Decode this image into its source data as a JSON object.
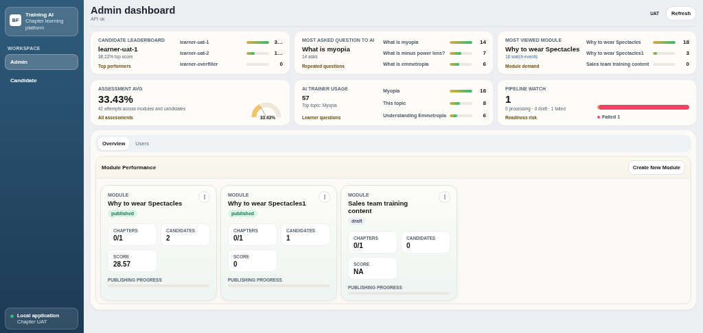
{
  "sidebar": {
    "brand": {
      "initials": "BF",
      "title": "Training AI",
      "subtitle": "Chapter learning platform"
    },
    "section": "WORKSPACE",
    "items": [
      {
        "label": "Admin",
        "selected": true
      },
      {
        "label": "Candidate",
        "selected": false
      }
    ],
    "footer": {
      "title": "Local application",
      "subtitle": "Chapter UAT",
      "connected": true
    }
  },
  "header": {
    "title": "Admin dashboard",
    "subtitle": "API ok",
    "environment": "UAT",
    "button": "Refresh"
  },
  "cards": [
    {
      "kind": "bars",
      "label": "CANDIDATE LEADERBOARD",
      "title": "learner-uat-1",
      "subtitle": "38.22% top score",
      "footer": "Top performers",
      "rows": [
        {
          "label": "learner-uat-1",
          "value": "3…",
          "level": 1
        },
        {
          "label": "learner-uat-2",
          "value": "1…",
          "level": 0.35
        },
        {
          "label": "learner-overfiller",
          "value": "0",
          "level": 0
        }
      ]
    },
    {
      "kind": "bars",
      "label": "MOST ASKED QUESTION TO AI",
      "title": "What is myopia",
      "subtitle": "14 asks",
      "footer": "Repeated questions",
      "rows": [
        {
          "label": "What is myopia",
          "value": "14",
          "level": 1
        },
        {
          "label": "What is minus power lens?",
          "value": "7",
          "level": 0.5
        },
        {
          "label": "What is emmetropia",
          "value": "6",
          "level": 0.43
        }
      ]
    },
    {
      "kind": "bars",
      "label": "MOST VIEWED MODULE",
      "title": "Why to wear Spectacles",
      "subtitle": "18 watch events",
      "footer": "Module demand",
      "rows": [
        {
          "label": "Why to wear Spectacles",
          "value": "18",
          "level": 1
        },
        {
          "label": "Why to wear Spectacles1",
          "value": "3",
          "level": 0.17
        },
        {
          "label": "Sales team training content",
          "value": "0",
          "level": 0
        }
      ]
    },
    {
      "kind": "gauge",
      "label": "ASSESSMENT AVG",
      "title": "33.43%",
      "subtitle": "42 attempts across modules and candidates",
      "footer": "All assessments",
      "gauge": {
        "reading": "33.43%"
      }
    },
    {
      "kind": "bars",
      "label": "AI TRAINER USAGE",
      "title": "57",
      "subtitle": "Top topic: Myopia",
      "footer": "Learner questions",
      "rows": [
        {
          "label": "Myopia",
          "value": "18",
          "level": 1
        },
        {
          "label": "This topic",
          "value": "8",
          "level": 0.44
        },
        {
          "label": "Understanding Emmetropia",
          "value": "6",
          "level": 0.33
        }
      ]
    },
    {
      "kind": "pipeline",
      "label": "PIPELINE WATCH",
      "title": "1",
      "subtitle": "0 processing · 0 draft · 1 failed",
      "footer": "Readiness risk",
      "bar": {
        "level": 1
      },
      "legend": {
        "label": "Failed 1",
        "color": "#ef4466"
      }
    }
  ],
  "tabs": [
    {
      "label": "Overview",
      "selected": true
    },
    {
      "label": "Users",
      "selected": false
    }
  ],
  "module_performance": {
    "title": "Module Performance",
    "button": "Create New Module",
    "modules": [
      {
        "eyebrow": "MODULE",
        "title": "Why to wear Spectacles",
        "status": {
          "label": "published",
          "kind": "published"
        },
        "stats": [
          {
            "label": "CHAPTERS",
            "value": "0/1"
          },
          {
            "label": "CANDIDATES",
            "value": "2"
          },
          {
            "label": "SCORE",
            "value": "28.57"
          }
        ],
        "progress_label": "PUBLISHING PROGRESS",
        "level": 0
      },
      {
        "eyebrow": "MODULE",
        "title": "Why to wear Spectacles1",
        "status": {
          "label": "published",
          "kind": "published"
        },
        "stats": [
          {
            "label": "CHAPTERS",
            "value": "0/1"
          },
          {
            "label": "CANDIDATES",
            "value": "1"
          },
          {
            "label": "SCORE",
            "value": "0"
          }
        ],
        "progress_label": "PUBLISHING PROGRESS",
        "level": 0
      },
      {
        "eyebrow": "MODULE",
        "title": "Sales team training content",
        "status": {
          "label": "draft",
          "kind": "draft"
        },
        "stats": [
          {
            "label": "CHAPTERS",
            "value": "0/1"
          },
          {
            "label": "CANDIDATES",
            "value": "0"
          },
          {
            "label": "SCORE",
            "value": "NA"
          }
        ],
        "progress_label": "PUBLISHING PROGRESS",
        "level": 0
      }
    ]
  }
}
